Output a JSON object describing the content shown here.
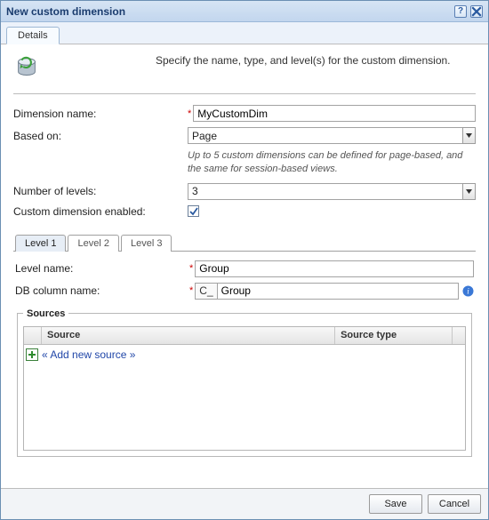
{
  "window": {
    "title": "New custom dimension"
  },
  "outerTab": {
    "label": "Details"
  },
  "intro": "Specify the name, type, and level(s) for the custom dimension.",
  "form": {
    "dimName": {
      "label": "Dimension name:",
      "value": "MyCustomDim"
    },
    "basedOn": {
      "label": "Based on:",
      "value": "Page",
      "hint": "Up to 5 custom dimensions can be defined for page-based, and the same for session-based views."
    },
    "numLevels": {
      "label": "Number of levels:",
      "value": "3"
    },
    "enabled": {
      "label": "Custom dimension enabled:",
      "checked": true
    }
  },
  "levelTabs": [
    {
      "label": "Level 1",
      "active": true
    },
    {
      "label": "Level 2",
      "active": false
    },
    {
      "label": "Level 3",
      "active": false
    }
  ],
  "level": {
    "name": {
      "label": "Level name:",
      "value": "Group"
    },
    "dbcol": {
      "label": "DB column name:",
      "prefix": "C_",
      "value": "Group"
    }
  },
  "sources": {
    "legend": "Sources",
    "columns": {
      "c2": "Source",
      "c3": "Source type"
    },
    "addLabel": "« Add new source »"
  },
  "buttons": {
    "save": "Save",
    "cancel": "Cancel"
  }
}
